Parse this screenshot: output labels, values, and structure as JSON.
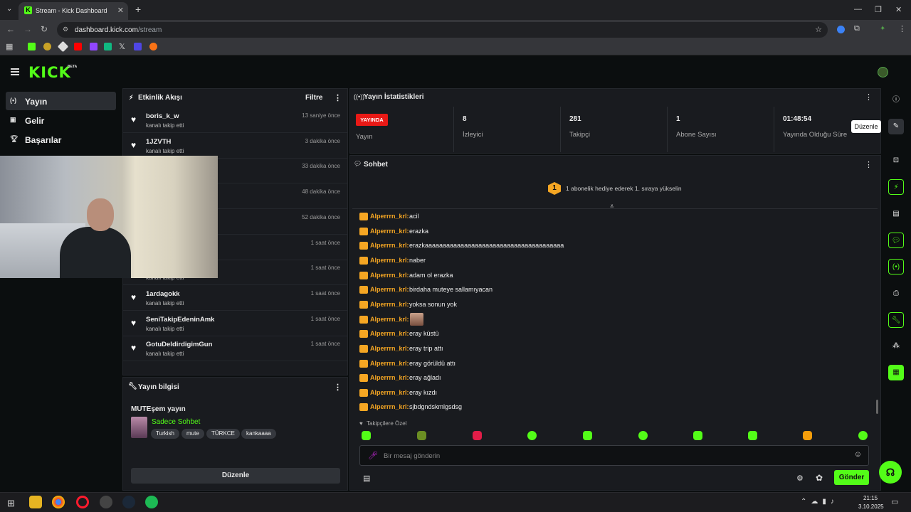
{
  "browser": {
    "tab_title": "Stream - Kick Dashboard",
    "url_host": "dashboard.kick.com",
    "url_path": "/stream"
  },
  "site": {
    "logo": "KICK",
    "beta": "BETA",
    "sidebar": [
      {
        "label": "Yayın",
        "icon": "broadcast-icon",
        "active": true
      },
      {
        "label": "Gelir",
        "icon": "revenue-icon"
      },
      {
        "label": "Başarılar",
        "icon": "trophy-icon"
      }
    ]
  },
  "activity": {
    "title": "Etkinlik Akışı",
    "filter": "Filtre",
    "items": [
      {
        "name": "boris_k_w",
        "sub": "kanalı takip etti",
        "time": "13 saniye önce"
      },
      {
        "name": "1JZVTH",
        "sub": "kanalı takip etti",
        "time": "3 dakika önce"
      },
      {
        "name": "",
        "sub": "",
        "time": "33 dakika önce"
      },
      {
        "name": "",
        "sub": "",
        "time": "48 dakika önce"
      },
      {
        "name": "",
        "sub": "",
        "time": "52 dakika önce"
      },
      {
        "name": "",
        "sub": "",
        "time": "1 saat önce"
      },
      {
        "name": "",
        "sub": "kanalı takip etti",
        "time": "1 saat önce"
      },
      {
        "name": "1ardagokk",
        "sub": "kanalı takip etti",
        "time": "1 saat önce"
      },
      {
        "name": "SeniTakipEdeninAmk",
        "sub": "kanalı takip etti",
        "time": "1 saat önce"
      },
      {
        "name": "GotuDeldirdigimGun",
        "sub": "kanalı takip etti",
        "time": "1 saat önce"
      }
    ]
  },
  "stream_info": {
    "title": "Yayın bilgisi",
    "stream_title": "MUTEşem yayın",
    "category": "Sadece Sohbet",
    "tags": [
      "Turkish",
      "mute",
      "TÜRKCE",
      "kankaaaa"
    ],
    "edit": "Düzenle"
  },
  "stats": {
    "title": "Yayın İstatistikleri",
    "live_badge": "YAYINDA",
    "items": [
      {
        "value": "",
        "label": "Yayın"
      },
      {
        "value": "8",
        "label": "İzleyici"
      },
      {
        "value": "281",
        "label": "Takipçi"
      },
      {
        "value": "1",
        "label": "Abone Sayısı"
      },
      {
        "value": "01:48:54",
        "label": "Yayında Olduğu Süre"
      }
    ],
    "tooltip": "Düzenle"
  },
  "chat": {
    "title": "Sohbet",
    "promo_rank": "1",
    "promo_text": "1 abonelik hediye ederek 1. sıraya yükselin",
    "messages": [
      {
        "user": "Alperrrn_krl",
        "text": "acil"
      },
      {
        "user": "Alperrrn_krl",
        "text": "erazka"
      },
      {
        "user": "Alperrrn_krl",
        "text": "erazkaaaaaaaaaaaaaaaaaaaaaaaaaaaaaaaaaaaaaaa"
      },
      {
        "user": "Alperrrn_krl",
        "text": "naber"
      },
      {
        "user": "Alperrrn_krl",
        "text": "adam ol erazka"
      },
      {
        "user": "Alperrrn_krl",
        "text": "birdaha muteye sallamıyacan"
      },
      {
        "user": "Alperrrn_krl",
        "text": "yoksa sonun yok"
      },
      {
        "user": "Alperrrn_krl",
        "text": ""
      },
      {
        "user": "Alperrrn_krl",
        "text": "eray küstü"
      },
      {
        "user": "Alperrrn_krl",
        "text": "eray trip attı"
      },
      {
        "user": "Alperrrn_krl",
        "text": "eray görüldü attı"
      },
      {
        "user": "Alperrrn_krl",
        "text": "eray ağladı"
      },
      {
        "user": "Alperrrn_krl",
        "text": "eray kızdı"
      },
      {
        "user": "Alperrrn_krl",
        "text": "sjbdgndskmlgsdsg"
      }
    ],
    "emote_section": "Takipçilere Özel",
    "input_placeholder": "Bir mesaj gönderin",
    "send": "Gönder"
  },
  "taskbar": {
    "time": "21:15",
    "date": "3.10.2025"
  },
  "colors": {
    "accent": "#53fc18",
    "live": "#e91916",
    "badge": "#f5a623"
  }
}
